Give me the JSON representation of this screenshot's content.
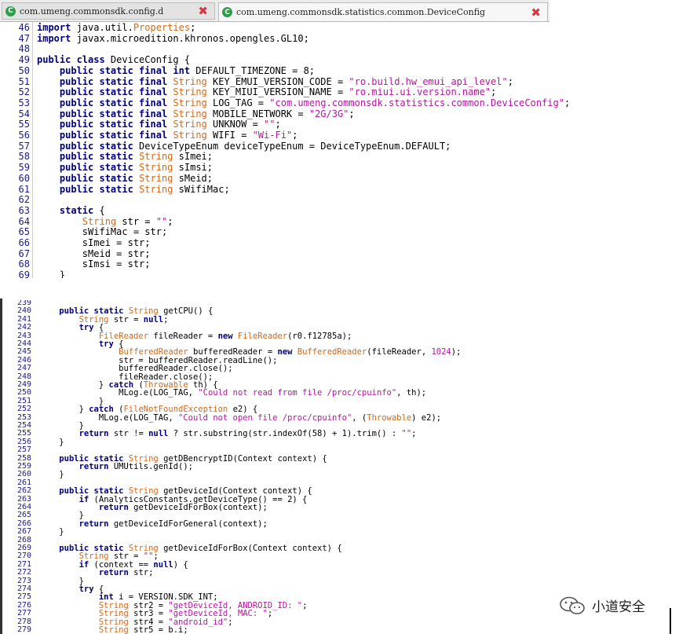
{
  "tabs": [
    {
      "label": "com.umeng.commonsdk.config.d",
      "icon": "class-c-icon",
      "close_icon": "close-x-icon"
    },
    {
      "label": "com.umeng.commonsdk.statistics.common.DeviceConfig",
      "icon": "class-c-icon",
      "close_icon": "close-x-icon"
    }
  ],
  "colors": {
    "keyword": "#000080",
    "type": "#d2691e",
    "string": "#b5179e",
    "line_number": "#1a1a8c",
    "close": "#d9363e",
    "class_icon": "#2e9e4b"
  },
  "panel1": {
    "lines": [
      {
        "n": "46",
        "t": [
          [
            "k",
            "import"
          ],
          [
            "p",
            " java.util."
          ],
          [
            "y",
            "Properties"
          ],
          [
            "p",
            ";"
          ]
        ]
      },
      {
        "n": "47",
        "t": [
          [
            "k",
            "import"
          ],
          [
            "p",
            " javax.microedition.khronos.opengles.GL10;"
          ]
        ]
      },
      {
        "n": "48",
        "t": []
      },
      {
        "n": "49",
        "t": [
          [
            "k",
            "public class"
          ],
          [
            "p",
            " DeviceConfig {"
          ]
        ]
      },
      {
        "n": "50",
        "t": [
          [
            "p",
            "    "
          ],
          [
            "k",
            "public static final int"
          ],
          [
            "p",
            " DEFAULT_TIMEZONE = 8;"
          ]
        ]
      },
      {
        "n": "51",
        "t": [
          [
            "p",
            "    "
          ],
          [
            "k",
            "public static final"
          ],
          [
            "p",
            " "
          ],
          [
            "y",
            "String"
          ],
          [
            "p",
            " KEY_EMUI_VERSION_CODE = "
          ],
          [
            "s",
            "\"ro.build.hw_emui_api_level\""
          ],
          [
            "p",
            ";"
          ]
        ]
      },
      {
        "n": "52",
        "t": [
          [
            "p",
            "    "
          ],
          [
            "k",
            "public static final"
          ],
          [
            "p",
            " "
          ],
          [
            "y",
            "String"
          ],
          [
            "p",
            " KEY_MIUI_VERSION_NAME = "
          ],
          [
            "s",
            "\"ro.miui.ui.version.name\""
          ],
          [
            "p",
            ";"
          ]
        ]
      },
      {
        "n": "53",
        "t": [
          [
            "p",
            "    "
          ],
          [
            "k",
            "public static final"
          ],
          [
            "p",
            " "
          ],
          [
            "y",
            "String"
          ],
          [
            "p",
            " LOG_TAG = "
          ],
          [
            "s",
            "\"com.umeng.commonsdk.statistics.common.DeviceConfig\""
          ],
          [
            "p",
            ";"
          ]
        ]
      },
      {
        "n": "54",
        "t": [
          [
            "p",
            "    "
          ],
          [
            "k",
            "public static final"
          ],
          [
            "p",
            " "
          ],
          [
            "y",
            "String"
          ],
          [
            "p",
            " MOBILE_NETWORK = "
          ],
          [
            "s",
            "\"2G/3G\""
          ],
          [
            "p",
            ";"
          ]
        ]
      },
      {
        "n": "55",
        "t": [
          [
            "p",
            "    "
          ],
          [
            "k",
            "public static final"
          ],
          [
            "p",
            " "
          ],
          [
            "y",
            "String"
          ],
          [
            "p",
            " UNKNOW = "
          ],
          [
            "s",
            "\"\""
          ],
          [
            "p",
            ";"
          ]
        ]
      },
      {
        "n": "56",
        "t": [
          [
            "p",
            "    "
          ],
          [
            "k",
            "public static final"
          ],
          [
            "p",
            " "
          ],
          [
            "y",
            "String"
          ],
          [
            "p",
            " WIFI = "
          ],
          [
            "s",
            "\"Wi-Fi\""
          ],
          [
            "p",
            ";"
          ]
        ]
      },
      {
        "n": "57",
        "t": [
          [
            "p",
            "    "
          ],
          [
            "k",
            "public static"
          ],
          [
            "p",
            " DeviceTypeEnum deviceTypeEnum = DeviceTypeEnum.DEFAULT;"
          ]
        ]
      },
      {
        "n": "58",
        "t": [
          [
            "p",
            "    "
          ],
          [
            "k",
            "public static"
          ],
          [
            "p",
            " "
          ],
          [
            "y",
            "String"
          ],
          [
            "p",
            " sImei;"
          ]
        ]
      },
      {
        "n": "59",
        "t": [
          [
            "p",
            "    "
          ],
          [
            "k",
            "public static"
          ],
          [
            "p",
            " "
          ],
          [
            "y",
            "String"
          ],
          [
            "p",
            " sImsi;"
          ]
        ]
      },
      {
        "n": "60",
        "t": [
          [
            "p",
            "    "
          ],
          [
            "k",
            "public static"
          ],
          [
            "p",
            " "
          ],
          [
            "y",
            "String"
          ],
          [
            "p",
            " sMeid;"
          ]
        ]
      },
      {
        "n": "61",
        "t": [
          [
            "p",
            "    "
          ],
          [
            "k",
            "public static"
          ],
          [
            "p",
            " "
          ],
          [
            "y",
            "String"
          ],
          [
            "p",
            " sWifiMac;"
          ]
        ]
      },
      {
        "n": "62",
        "t": []
      },
      {
        "n": "63",
        "t": [
          [
            "p",
            "    "
          ],
          [
            "k",
            "static"
          ],
          [
            "p",
            " {"
          ]
        ]
      },
      {
        "n": "64",
        "t": [
          [
            "p",
            "        "
          ],
          [
            "y",
            "String"
          ],
          [
            "p",
            " str = "
          ],
          [
            "s",
            "\"\""
          ],
          [
            "p",
            ";"
          ]
        ]
      },
      {
        "n": "65",
        "t": [
          [
            "p",
            "        sWifiMac = str;"
          ]
        ]
      },
      {
        "n": "66",
        "t": [
          [
            "p",
            "        sImei = str;"
          ]
        ]
      },
      {
        "n": "67",
        "t": [
          [
            "p",
            "        sMeid = str;"
          ]
        ]
      },
      {
        "n": "68",
        "t": [
          [
            "p",
            "        sImsi = str;"
          ]
        ]
      },
      {
        "n": "69",
        "t": [
          [
            "p",
            "    }"
          ]
        ]
      }
    ]
  },
  "panel2": {
    "lines": [
      {
        "n": "239",
        "t": []
      },
      {
        "n": "240",
        "t": [
          [
            "p",
            "    "
          ],
          [
            "k",
            "public static"
          ],
          [
            "p",
            " "
          ],
          [
            "y",
            "String"
          ],
          [
            "p",
            " getCPU() {"
          ]
        ]
      },
      {
        "n": "241",
        "t": [
          [
            "p",
            "        "
          ],
          [
            "y",
            "String"
          ],
          [
            "p",
            " str = "
          ],
          [
            "k",
            "null"
          ],
          [
            "p",
            ";"
          ]
        ]
      },
      {
        "n": "242",
        "t": [
          [
            "p",
            "        "
          ],
          [
            "k",
            "try"
          ],
          [
            "p",
            " {"
          ]
        ]
      },
      {
        "n": "243",
        "t": [
          [
            "p",
            "            "
          ],
          [
            "y",
            "FileReader"
          ],
          [
            "p",
            " fileReader = "
          ],
          [
            "k",
            "new"
          ],
          [
            "p",
            " "
          ],
          [
            "y",
            "FileReader"
          ],
          [
            "p",
            "(r0.f12785a);"
          ]
        ]
      },
      {
        "n": "244",
        "t": [
          [
            "p",
            "            "
          ],
          [
            "k",
            "try"
          ],
          [
            "p",
            " {"
          ]
        ]
      },
      {
        "n": "245",
        "t": [
          [
            "p",
            "                "
          ],
          [
            "y",
            "BufferedReader"
          ],
          [
            "p",
            " bufferedReader = "
          ],
          [
            "k",
            "new"
          ],
          [
            "p",
            " "
          ],
          [
            "y",
            "BufferedReader"
          ],
          [
            "p",
            "(fileReader, "
          ],
          [
            "s",
            "1024"
          ],
          [
            "p",
            ");"
          ]
        ]
      },
      {
        "n": "246",
        "t": [
          [
            "p",
            "                str = bufferedReader.readLine();"
          ]
        ]
      },
      {
        "n": "247",
        "t": [
          [
            "p",
            "                bufferedReader.close();"
          ]
        ]
      },
      {
        "n": "248",
        "t": [
          [
            "p",
            "                fileReader.close();"
          ]
        ]
      },
      {
        "n": "249",
        "t": [
          [
            "p",
            "            } "
          ],
          [
            "k",
            "catch"
          ],
          [
            "p",
            " ("
          ],
          [
            "y",
            "Throwable"
          ],
          [
            "p",
            " th) {"
          ]
        ]
      },
      {
        "n": "250",
        "t": [
          [
            "p",
            "                MLog.e(LOG_TAG, "
          ],
          [
            "s",
            "\"Could not read from file /proc/cpuinfo\""
          ],
          [
            "p",
            ", th);"
          ]
        ]
      },
      {
        "n": "251",
        "t": [
          [
            "p",
            "            }"
          ]
        ]
      },
      {
        "n": "252",
        "t": [
          [
            "p",
            "        } "
          ],
          [
            "k",
            "catch"
          ],
          [
            "p",
            " ("
          ],
          [
            "y",
            "FileNotFoundException"
          ],
          [
            "p",
            " e2) {"
          ]
        ]
      },
      {
        "n": "253",
        "t": [
          [
            "p",
            "            MLog.e(LOG_TAG, "
          ],
          [
            "s",
            "\"Could not open file /proc/cpuinfo\""
          ],
          [
            "p",
            ", ("
          ],
          [
            "y",
            "Throwable"
          ],
          [
            "p",
            ") e2);"
          ]
        ]
      },
      {
        "n": "254",
        "t": [
          [
            "p",
            "        }"
          ]
        ]
      },
      {
        "n": "255",
        "t": [
          [
            "p",
            "        "
          ],
          [
            "k",
            "return"
          ],
          [
            "p",
            " str != "
          ],
          [
            "k",
            "null"
          ],
          [
            "p",
            " ? str.substring(str.indexOf(58) + 1).trim() : "
          ],
          [
            "s",
            "\"\""
          ],
          [
            "p",
            ";"
          ]
        ]
      },
      {
        "n": "256",
        "t": [
          [
            "p",
            "    }"
          ]
        ]
      },
      {
        "n": "257",
        "t": []
      },
      {
        "n": "258",
        "t": [
          [
            "p",
            "    "
          ],
          [
            "k",
            "public static"
          ],
          [
            "p",
            " "
          ],
          [
            "y",
            "String"
          ],
          [
            "p",
            " getDBencryptID(Context context) {"
          ]
        ]
      },
      {
        "n": "259",
        "t": [
          [
            "p",
            "        "
          ],
          [
            "k",
            "return"
          ],
          [
            "p",
            " UMUtils.genId();"
          ]
        ]
      },
      {
        "n": "260",
        "t": [
          [
            "p",
            "    }"
          ]
        ]
      },
      {
        "n": "261",
        "t": []
      },
      {
        "n": "262",
        "t": [
          [
            "p",
            "    "
          ],
          [
            "k",
            "public static"
          ],
          [
            "p",
            " "
          ],
          [
            "y",
            "String"
          ],
          [
            "p",
            " getDeviceId(Context context) {"
          ]
        ]
      },
      {
        "n": "263",
        "t": [
          [
            "p",
            "        "
          ],
          [
            "k",
            "if"
          ],
          [
            "p",
            " (AnalyticsConstants.getDeviceType() == 2) {"
          ]
        ]
      },
      {
        "n": "264",
        "t": [
          [
            "p",
            "            "
          ],
          [
            "k",
            "return"
          ],
          [
            "p",
            " getDeviceIdForBox(context);"
          ]
        ]
      },
      {
        "n": "265",
        "t": [
          [
            "p",
            "        }"
          ]
        ]
      },
      {
        "n": "266",
        "t": [
          [
            "p",
            "        "
          ],
          [
            "k",
            "return"
          ],
          [
            "p",
            " getDeviceIdForGeneral(context);"
          ]
        ]
      },
      {
        "n": "267",
        "t": [
          [
            "p",
            "    }"
          ]
        ]
      },
      {
        "n": "268",
        "t": []
      },
      {
        "n": "269",
        "t": [
          [
            "p",
            "    "
          ],
          [
            "k",
            "public static"
          ],
          [
            "p",
            " "
          ],
          [
            "y",
            "String"
          ],
          [
            "p",
            " getDeviceIdForBox(Context context) {"
          ]
        ]
      },
      {
        "n": "270",
        "t": [
          [
            "p",
            "        "
          ],
          [
            "y",
            "String"
          ],
          [
            "p",
            " str = "
          ],
          [
            "s",
            "\"\""
          ],
          [
            "p",
            ";"
          ]
        ]
      },
      {
        "n": "271",
        "t": [
          [
            "p",
            "        "
          ],
          [
            "k",
            "if"
          ],
          [
            "p",
            " (context == "
          ],
          [
            "k",
            "null"
          ],
          [
            "p",
            ") {"
          ]
        ]
      },
      {
        "n": "272",
        "t": [
          [
            "p",
            "            "
          ],
          [
            "k",
            "return"
          ],
          [
            "p",
            " str;"
          ]
        ]
      },
      {
        "n": "273",
        "t": [
          [
            "p",
            "        }"
          ]
        ]
      },
      {
        "n": "274",
        "t": [
          [
            "p",
            "        "
          ],
          [
            "k",
            "try"
          ],
          [
            "p",
            " {"
          ]
        ]
      },
      {
        "n": "275",
        "t": [
          [
            "p",
            "            "
          ],
          [
            "k",
            "int"
          ],
          [
            "p",
            " i = VERSION.SDK_INT;"
          ]
        ]
      },
      {
        "n": "276",
        "t": [
          [
            "p",
            "            "
          ],
          [
            "y",
            "String"
          ],
          [
            "p",
            " str2 = "
          ],
          [
            "s",
            "\"getDeviceId, ANDROID_ID: \""
          ],
          [
            "p",
            ";"
          ]
        ]
      },
      {
        "n": "277",
        "t": [
          [
            "p",
            "            "
          ],
          [
            "y",
            "String"
          ],
          [
            "p",
            " str3 = "
          ],
          [
            "s",
            "\"getDeviceId, MAC: \""
          ],
          [
            "p",
            ";"
          ]
        ]
      },
      {
        "n": "278",
        "t": [
          [
            "p",
            "            "
          ],
          [
            "y",
            "String"
          ],
          [
            "p",
            " str4 = "
          ],
          [
            "s",
            "\"android_id\""
          ],
          [
            "p",
            ";"
          ]
        ]
      },
      {
        "n": "279",
        "t": [
          [
            "p",
            "            "
          ],
          [
            "y",
            "String"
          ],
          [
            "p",
            " str5 = b.i;"
          ]
        ]
      }
    ]
  },
  "watermark": {
    "text": "小道安全",
    "icon": "wechat-icon"
  }
}
